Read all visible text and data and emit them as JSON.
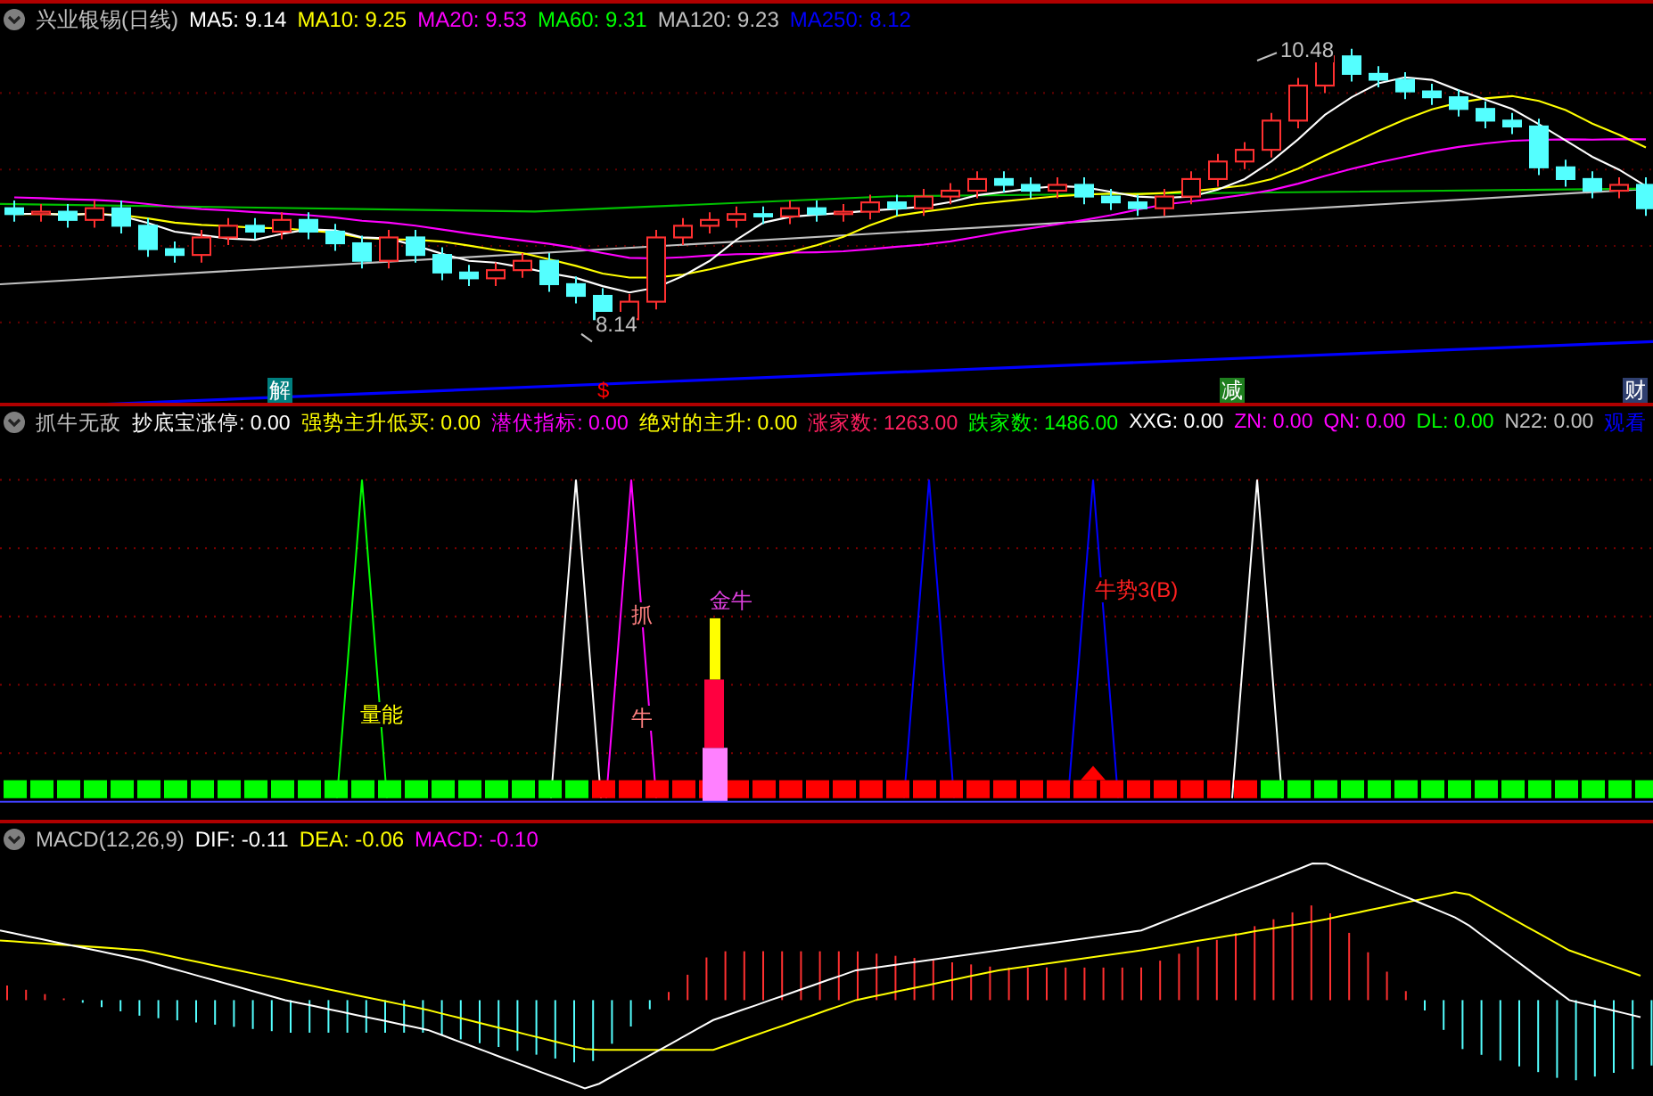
{
  "price_pane": {
    "title": "兴业银锡(日线)",
    "indicators": [
      {
        "label": "MA5:",
        "value": "9.14",
        "color": "#ffffff"
      },
      {
        "label": "MA10:",
        "value": "9.25",
        "color": "#ffff00"
      },
      {
        "label": "MA20:",
        "value": "9.53",
        "color": "#ff00ff"
      },
      {
        "label": "MA60:",
        "value": "9.31",
        "color": "#00ff00"
      },
      {
        "label": "MA120:",
        "value": "9.23",
        "color": "#c0c0c0"
      },
      {
        "label": "MA250:",
        "value": "8.12",
        "color": "#0000ff"
      }
    ],
    "high_label": "10.48",
    "low_label": "8.14",
    "markers": [
      {
        "text": "解",
        "kind": "badge",
        "color": "#007f7f"
      },
      {
        "text": "$",
        "kind": "plain",
        "color": "#ff0000"
      },
      {
        "text": "减",
        "kind": "badge",
        "color": "#1f7f1f"
      },
      {
        "text": "财",
        "kind": "badge",
        "color": "#2f3f6f"
      }
    ]
  },
  "signal_pane": {
    "title": "抓牛无敌",
    "indicators": [
      {
        "label": "抄底宝涨停:",
        "value": "0.00",
        "color": "#ffffff"
      },
      {
        "label": "强势主升低买:",
        "value": "0.00",
        "color": "#ffff00"
      },
      {
        "label": "潜伏指标:",
        "value": "0.00",
        "color": "#ff00ff"
      },
      {
        "label": "绝对的主升:",
        "value": "0.00",
        "color": "#ffff00"
      },
      {
        "label": "涨家数:",
        "value": "1263.00",
        "color": "#ff2060"
      },
      {
        "label": "跌家数:",
        "value": "1486.00",
        "color": "#00ff00"
      },
      {
        "label": "XXG:",
        "value": "0.00",
        "color": "#ffffff"
      },
      {
        "label": "ZN:",
        "value": "0.00",
        "color": "#ff00ff"
      },
      {
        "label": "QN:",
        "value": "0.00",
        "color": "#ff00ff"
      },
      {
        "label": "DL:",
        "value": "0.00",
        "color": "#00ff00"
      },
      {
        "label": "N22:",
        "value": "0.00",
        "color": "#c0c0c0"
      },
      {
        "label": "观看",
        "color": "#0000ff"
      }
    ],
    "labels": [
      {
        "text": "量能",
        "color": "#ffff00"
      },
      {
        "text": "抓",
        "color": "#ff8080"
      },
      {
        "text": "牛",
        "color": "#ff8080"
      },
      {
        "text": "金牛",
        "color": "#e040e0"
      },
      {
        "text": "牛势3(B)",
        "color": "#ff2020"
      }
    ]
  },
  "macd_pane": {
    "title": "MACD(12,26,9)",
    "indicators": [
      {
        "label": "DIF:",
        "value": "-0.11",
        "color": "#ffffff"
      },
      {
        "label": "DEA:",
        "value": "-0.06",
        "color": "#ffff00"
      },
      {
        "label": "MACD:",
        "value": "-0.10",
        "color": "#ff00ff"
      }
    ]
  }
}
